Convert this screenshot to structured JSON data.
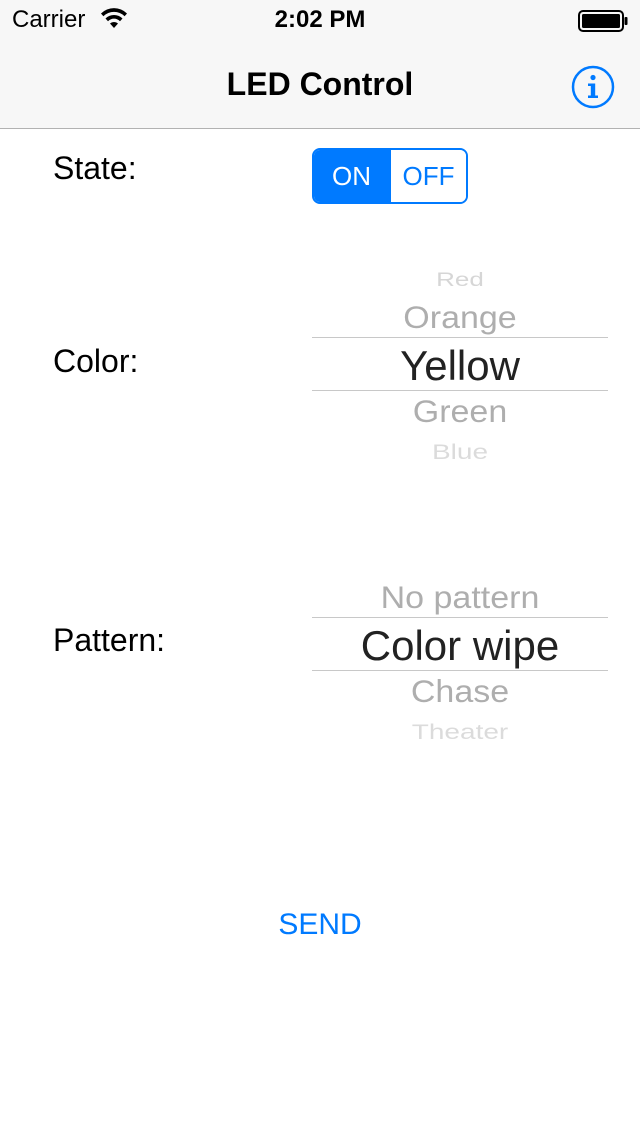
{
  "status_bar": {
    "carrier": "Carrier",
    "time": "2:02 PM",
    "wifi_icon": "wifi-icon",
    "battery_icon": "battery-icon"
  },
  "nav": {
    "title": "LED Control",
    "info_icon": "info-icon"
  },
  "state": {
    "label": "State:",
    "options": [
      "ON",
      "OFF"
    ],
    "selected": "ON"
  },
  "color": {
    "label": "Color:",
    "visible_options": [
      "Red",
      "Orange",
      "Yellow",
      "Green",
      "Blue"
    ],
    "selected": "Yellow"
  },
  "pattern": {
    "label": "Pattern:",
    "visible_options": [
      "No pattern",
      "Color wipe",
      "Chase",
      "Theater"
    ],
    "selected": "Color wipe"
  },
  "send": {
    "label": "SEND"
  },
  "colors": {
    "accent": "#007aff",
    "bar_background": "#f7f7f7",
    "picker_dim_text": "#9b9b9b",
    "picker_selected_text": "#222222"
  }
}
